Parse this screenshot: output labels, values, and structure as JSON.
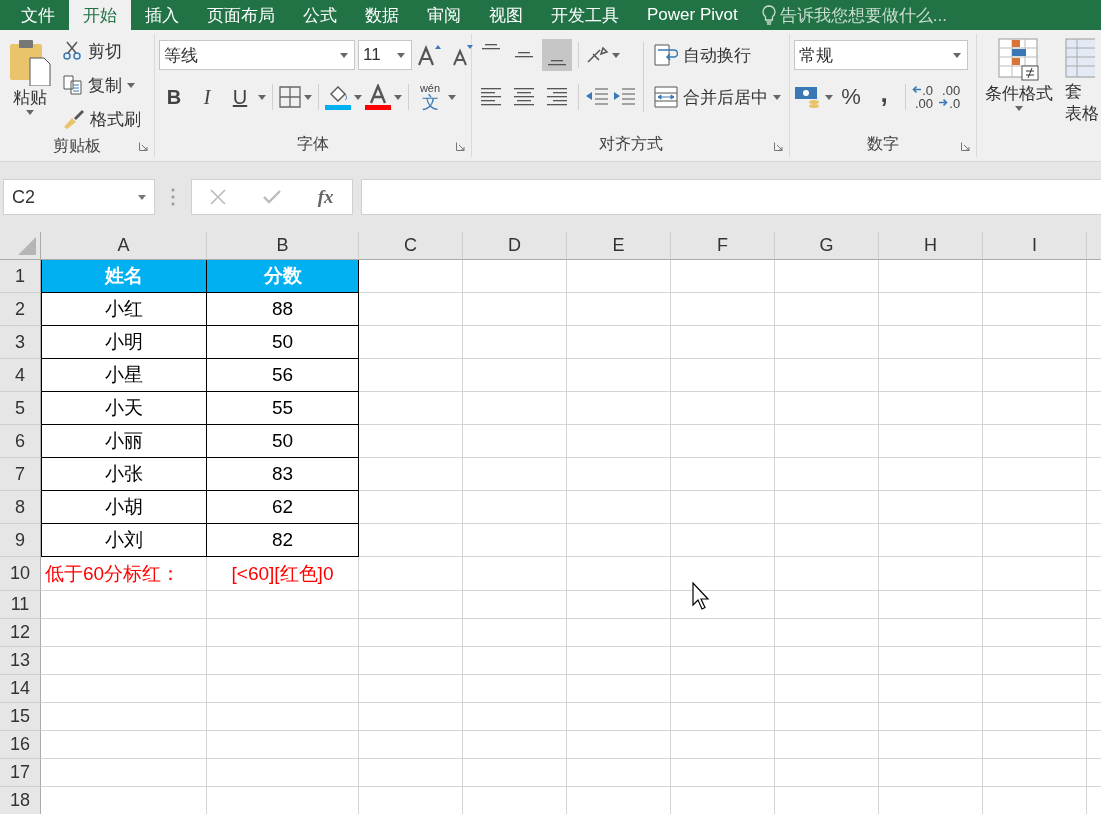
{
  "tabs": [
    {
      "label": "文件",
      "selected": false
    },
    {
      "label": "开始",
      "selected": true
    },
    {
      "label": "插入",
      "selected": false
    },
    {
      "label": "页面布局",
      "selected": false
    },
    {
      "label": "公式",
      "selected": false
    },
    {
      "label": "数据",
      "selected": false
    },
    {
      "label": "审阅",
      "selected": false
    },
    {
      "label": "视图",
      "selected": false
    },
    {
      "label": "开发工具",
      "selected": false
    },
    {
      "label": "Power Pivot",
      "selected": false
    }
  ],
  "tell_me": {
    "placeholder": "告诉我您想要做什么..."
  },
  "clipboard": {
    "paste": "粘贴",
    "cut": "剪切",
    "copy": "复制",
    "format_painter": "格式刷",
    "label": "剪贴板"
  },
  "font": {
    "name": "等线",
    "size": "11",
    "bold": "B",
    "italic": "I",
    "underline": "U",
    "phonetic_top": "wén",
    "phonetic_char": "文",
    "label": "字体"
  },
  "alignment": {
    "vertical": [
      {
        "selected": false
      },
      {
        "selected": false
      },
      {
        "selected": true
      }
    ],
    "wrap": "自动换行",
    "merge": "合并后居中",
    "label": "对齐方式"
  },
  "number": {
    "format": "常规",
    "percent": "%",
    "comma": ",",
    "increase_decimal": [
      ".0",
      ".00"
    ],
    "decrease_decimal": [
      ".00",
      ".0"
    ],
    "label": "数字"
  },
  "styles": {
    "conditional": "条件格式",
    "table_format": [
      "套",
      "表格"
    ]
  },
  "formula_bar": {
    "name_box": "C2",
    "function": "fx"
  },
  "sheet": {
    "columns": [
      "A",
      "B",
      "C",
      "D",
      "E",
      "F",
      "G",
      "H",
      "I"
    ],
    "rows": [
      {
        "number": "1",
        "kind": "header",
        "cells": [
          "姓名",
          "分数"
        ]
      },
      {
        "number": "2",
        "kind": "data",
        "cells": [
          "小红",
          "88"
        ]
      },
      {
        "number": "3",
        "kind": "data",
        "cells": [
          "小明",
          "50"
        ]
      },
      {
        "number": "4",
        "kind": "data",
        "cells": [
          "小星",
          "56"
        ]
      },
      {
        "number": "5",
        "kind": "data",
        "cells": [
          "小天",
          "55"
        ]
      },
      {
        "number": "6",
        "kind": "data",
        "cells": [
          "小丽",
          "50"
        ]
      },
      {
        "number": "7",
        "kind": "data",
        "cells": [
          "小张",
          "83"
        ]
      },
      {
        "number": "8",
        "kind": "data",
        "cells": [
          "小胡",
          "62"
        ]
      },
      {
        "number": "9",
        "kind": "data",
        "cells": [
          "小刘",
          "82"
        ]
      },
      {
        "number": "10",
        "kind": "note",
        "cells": [
          "低于60分标红：",
          "[<60][红色]0"
        ]
      },
      {
        "number": "11",
        "kind": "empty"
      },
      {
        "number": "12",
        "kind": "empty"
      },
      {
        "number": "13",
        "kind": "empty"
      },
      {
        "number": "14",
        "kind": "empty"
      },
      {
        "number": "15",
        "kind": "empty"
      },
      {
        "number": "16",
        "kind": "empty"
      },
      {
        "number": "17",
        "kind": "empty"
      },
      {
        "number": "18",
        "kind": "empty"
      }
    ]
  }
}
